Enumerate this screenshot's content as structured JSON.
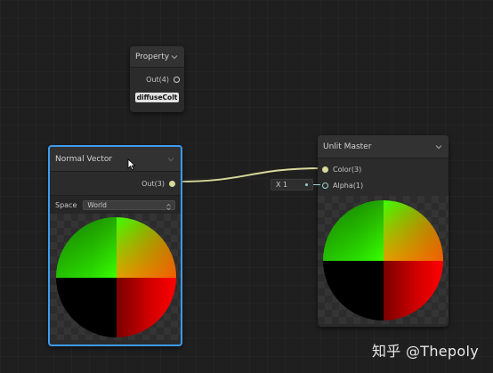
{
  "property_node": {
    "title": "Property",
    "output_label": "Out(4)",
    "property_name": "diffuseColt"
  },
  "normal_vector_node": {
    "title": "Normal Vector",
    "output_label": "Out(3)",
    "space_label": "Space",
    "space_value": "World"
  },
  "unlit_master_node": {
    "title": "Unlit Master",
    "inputs": [
      {
        "label": "Color(3)"
      },
      {
        "label": "Alpha(1)"
      }
    ],
    "alpha_default": "X 1"
  },
  "watermark": "知乎 @Thepoly",
  "colors": {
    "selection": "#3d9bf0",
    "wire": "#d8d89a",
    "alpha_port": "#9ad0d8"
  },
  "icons": [
    "chevron-down-icon",
    "mouse-cursor-icon",
    "port-circle-icon"
  ]
}
